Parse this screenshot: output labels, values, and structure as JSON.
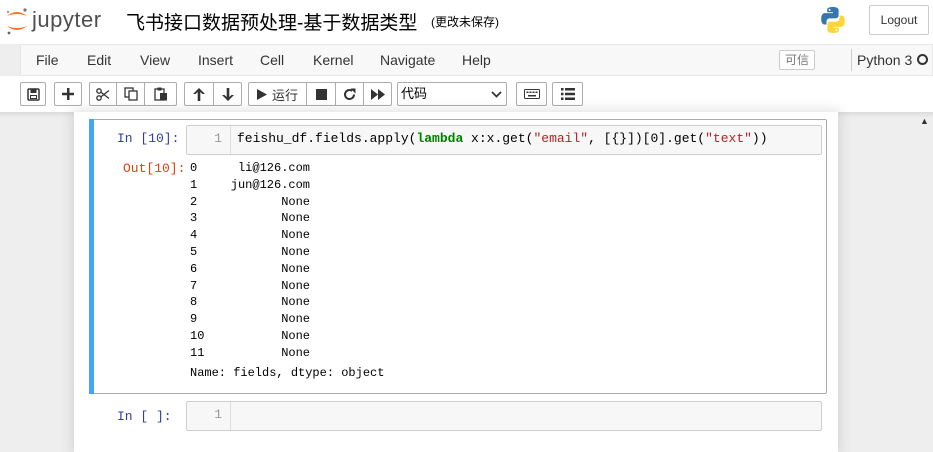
{
  "header": {
    "app_name": "jupyter",
    "notebook_title": "飞书接口数据预处理-基于数据类型",
    "save_status": "(更改未保存)",
    "logout_label": "Logout"
  },
  "menubar": {
    "items": [
      "File",
      "Edit",
      "View",
      "Insert",
      "Cell",
      "Kernel",
      "Navigate",
      "Help"
    ],
    "trusted_label": "可信",
    "kernel_name": "Python 3"
  },
  "toolbar": {
    "buttons": [
      "save-icon",
      "plus-icon",
      "scissors-icon",
      "copy-icon",
      "paste-icon",
      "arrow-up-icon",
      "arrow-down-icon",
      "run-icon",
      "stop-icon",
      "restart-icon",
      "fast-forward-icon",
      "keyboard-icon",
      "list-icon"
    ],
    "run_label": "运行",
    "cell_type_value": "代码"
  },
  "cells": [
    {
      "in_prompt": "In [10]:",
      "line_number": "1",
      "code": "feishu_df.fields.apply(lambda x:x.get(\"email\", [{}])[0].get(\"text\"))",
      "out_prompt": "Out[10]:",
      "output_rows": [
        {
          "idx": "0",
          "val": "li@126.com"
        },
        {
          "idx": "1",
          "val": "jun@126.com"
        },
        {
          "idx": "2",
          "val": "None"
        },
        {
          "idx": "3",
          "val": "None"
        },
        {
          "idx": "4",
          "val": "None"
        },
        {
          "idx": "5",
          "val": "None"
        },
        {
          "idx": "6",
          "val": "None"
        },
        {
          "idx": "7",
          "val": "None"
        },
        {
          "idx": "8",
          "val": "None"
        },
        {
          "idx": "9",
          "val": "None"
        },
        {
          "idx": "10",
          "val": "None"
        },
        {
          "idx": "11",
          "val": "None"
        }
      ],
      "output_footer": "Name: fields, dtype: object"
    },
    {
      "in_prompt": "In [ ]:",
      "line_number": "1",
      "code": ""
    }
  ],
  "colors": {
    "selected_cell_bar": "#42a5f5",
    "in_prompt": "#303f9f",
    "out_prompt": "#d84315",
    "keyword": "#008000",
    "string": "#ba2121"
  }
}
